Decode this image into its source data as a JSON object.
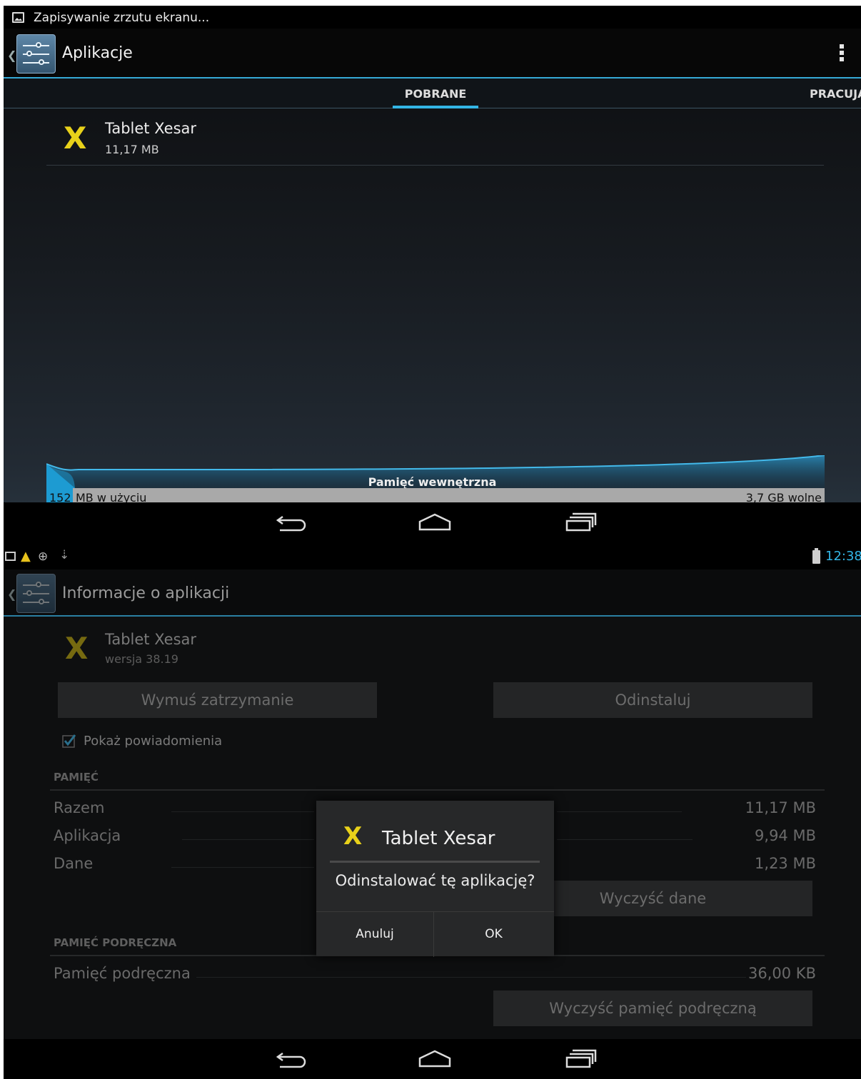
{
  "top": {
    "notification": {
      "text": "Zapisywanie zrzutu ekranu..."
    },
    "actionbar": {
      "title": "Aplikacje"
    },
    "tabs": [
      {
        "label": "POBRANE",
        "selected": true
      },
      {
        "label": "PRACUJĄ",
        "selected": false
      }
    ],
    "apps": [
      {
        "name": "Tablet Xesar",
        "size": "11,17 MB"
      }
    ],
    "storage": {
      "title": "Pamięć wewnętrzna",
      "used_number": "152",
      "used_label": "MB w użyciu",
      "free": "3,7 GB wolne",
      "used_fraction": 0.034
    }
  },
  "bottom": {
    "status": {
      "time": "12:38"
    },
    "actionbar": {
      "title": "Informacje o aplikacji"
    },
    "app": {
      "name": "Tablet Xesar",
      "version": "wersja 38.19"
    },
    "buttons": {
      "force_stop": "Wymuś zatrzymanie",
      "uninstall": "Odinstaluj",
      "clear_data": "Wyczyść dane",
      "clear_cache": "Wyczyść pamięć podręczną"
    },
    "notifications": {
      "label": "Pokaż powiadomienia",
      "checked": true
    },
    "memory": {
      "header": "PAMIĘĆ",
      "rows": [
        {
          "label": "Razem",
          "value": "11,17 MB"
        },
        {
          "label": "Aplikacja",
          "value": "9,94 MB"
        },
        {
          "label": "Dane",
          "value": "1,23 MB"
        }
      ]
    },
    "cache": {
      "header": "PAMIĘĆ PODRĘCZNA",
      "rows": [
        {
          "label": "Pamięć podręczna",
          "value": "36,00 KB"
        }
      ]
    },
    "dialog": {
      "icon_letter": "X",
      "title": "Tablet Xesar",
      "message": "Odinstalować tę aplikację?",
      "cancel": "Anuluj",
      "ok": "OK"
    }
  },
  "icons": {
    "app_letter": "X",
    "app_color": "#e8d11a",
    "accent": "#33b5e5"
  }
}
